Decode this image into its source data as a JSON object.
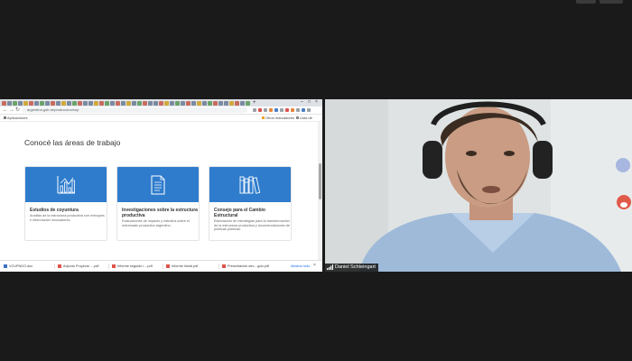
{
  "browser": {
    "url": "argentina.gob.ar/produccion/cep",
    "bookmarks": [
      {
        "label": "Aplicaciones"
      },
      {
        "label": "Otros marcadores"
      },
      {
        "label": "Lista de lectura"
      }
    ]
  },
  "page": {
    "section_title": "Conocé las áreas de trabajo",
    "cards": [
      {
        "icon": "bar-chart-icon",
        "title": "Estudios de coyuntura",
        "description": "Análisis de la estructura productiva con enfoques e información innovadores."
      },
      {
        "icon": "document-icon",
        "title": "Investigaciones sobre la estructura productiva",
        "description": "Evaluaciones de impacto y estudios sobre el entramado productivo argentino."
      },
      {
        "icon": "books-icon",
        "title": "Consejo para el Cambio Estructural",
        "description": "Elaboración de estrategias para la transformación de la estructura productiva y recomendaciones de políticas públicas."
      }
    ],
    "card_color": "#2f7ccd"
  },
  "downloads": {
    "items": [
      {
        "name": "VCUPNDO.doc"
      },
      {
        "name": "Adjunto Proyecto ....pdf"
      },
      {
        "name": "Informe seguido i....pdf"
      },
      {
        "name": "Informe itorial.pdf"
      },
      {
        "name": "Presentación dev....gob.pdf"
      }
    ],
    "show_all": "Mostrar todo"
  },
  "participant": {
    "name": "Daniel Schteingart"
  }
}
